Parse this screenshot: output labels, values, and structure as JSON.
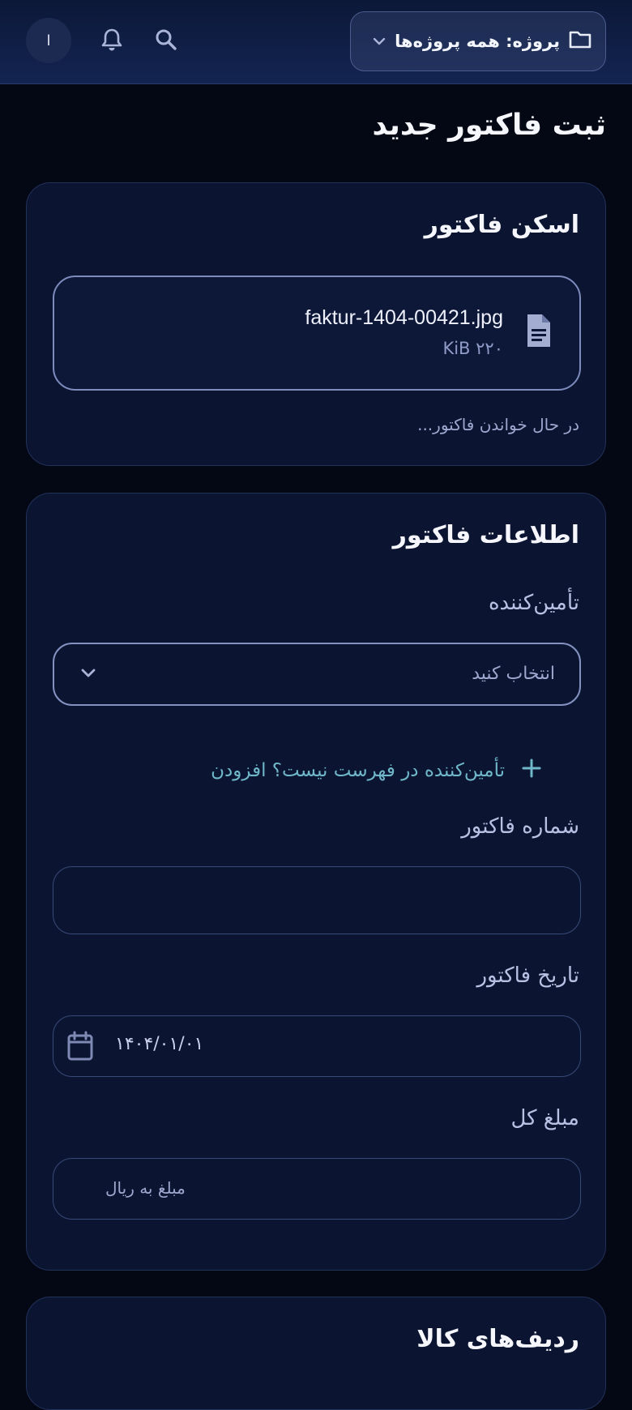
{
  "header": {
    "project_selector_label": "پروژه: همه پروژه‌ها",
    "avatar_initial": "ا",
    "icons": [
      "folder-icon",
      "chevron-down-icon",
      "search-icon",
      "bell-icon"
    ]
  },
  "page": {
    "title": "ثبت فاکتور جدید"
  },
  "scan_card": {
    "title": "اسکن فاکتور",
    "file_name": "faktur-1404-00421.jpg",
    "file_size": "۲۲۰ KiB",
    "status": "در حال خواندن فاکتور..."
  },
  "invoice_card": {
    "title": "اطلاعات فاکتور",
    "supplier_label": "تأمین‌کننده",
    "supplier_select_value": "انتخاب کنید",
    "add_supplier_link": "تأمین‌کننده در فهرست نیست؟ افزودن",
    "invoice_number_label": "شماره فاکتور",
    "invoice_number_value": "",
    "invoice_date_label": "تاریخ فاکتور",
    "invoice_date_value": "۱۴۰۴/۰۱/۰۱",
    "total_amount_label": "مبلغ کل",
    "total_amount_placeholder": "مبلغ به ریال"
  },
  "items_card": {
    "title": "ردیف‌های کالا"
  },
  "colors": {
    "background": "#040815",
    "card": "#0b1431",
    "accent_link": "#6fb7c9",
    "header": "#132451"
  }
}
